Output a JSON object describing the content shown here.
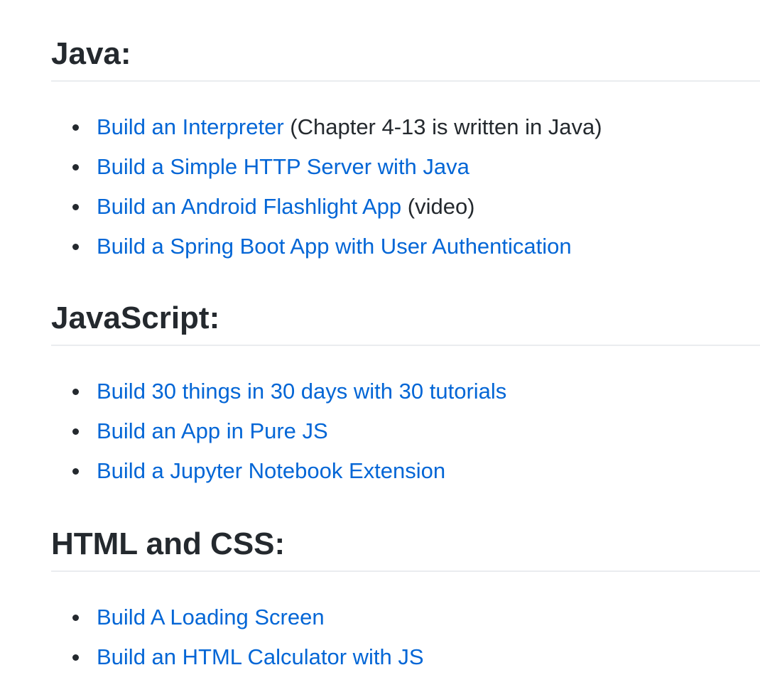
{
  "sections": [
    {
      "heading": "Java:",
      "items": [
        {
          "link": "Build an Interpreter",
          "note": " (Chapter 4-13 is written in Java)"
        },
        {
          "link": "Build a Simple HTTP Server with Java",
          "note": ""
        },
        {
          "link": "Build an Android Flashlight App",
          "note": " (video)"
        },
        {
          "link": "Build a Spring Boot App with User Authentication",
          "note": ""
        }
      ]
    },
    {
      "heading": "JavaScript:",
      "items": [
        {
          "link": "Build 30 things in 30 days with 30 tutorials",
          "note": ""
        },
        {
          "link": "Build an App in Pure JS",
          "note": ""
        },
        {
          "link": "Build a Jupyter Notebook Extension",
          "note": ""
        }
      ]
    },
    {
      "heading": "HTML and CSS:",
      "items": [
        {
          "link": "Build A Loading Screen",
          "note": ""
        },
        {
          "link": "Build an HTML Calculator with JS",
          "note": ""
        }
      ]
    }
  ],
  "colors": {
    "link": "#0366d6",
    "text": "#24292e",
    "divider": "#eaecef"
  }
}
